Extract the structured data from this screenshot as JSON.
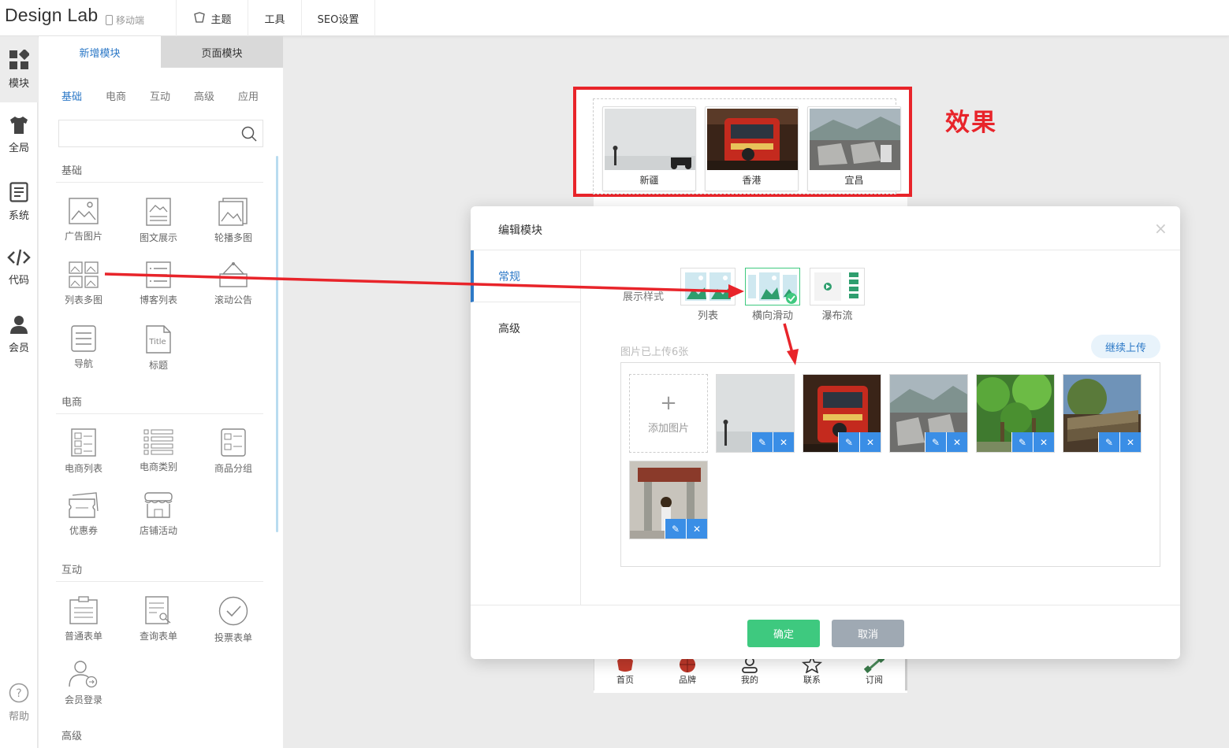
{
  "app": {
    "title": "Design Lab",
    "mobile_label": "移动端"
  },
  "topnav": [
    {
      "label": "主题",
      "icon": "theme-icon"
    },
    {
      "label": "工具"
    },
    {
      "label": "SEO设置"
    }
  ],
  "rail": [
    {
      "label": "模块",
      "icon": "modules-icon",
      "active": true
    },
    {
      "label": "全局",
      "icon": "shirt-icon"
    },
    {
      "label": "系统",
      "icon": "document-icon"
    },
    {
      "label": "代码",
      "icon": "code-icon"
    },
    {
      "label": "会员",
      "icon": "user-icon"
    },
    {
      "label": "帮助",
      "icon": "help-icon"
    }
  ],
  "panel": {
    "tabs": [
      {
        "label": "新增模块",
        "active": true
      },
      {
        "label": "页面模块"
      }
    ],
    "categories": [
      "基础",
      "电商",
      "互动",
      "高级",
      "应用"
    ],
    "search_placeholder": "",
    "sections": [
      {
        "title": "基础",
        "items": [
          "广告图片",
          "图文展示",
          "轮播多图",
          "列表多图",
          "博客列表",
          "滚动公告",
          "导航",
          "标题"
        ]
      },
      {
        "title": "电商",
        "items": [
          "电商列表",
          "电商类别",
          "商品分组",
          "优惠券",
          "店铺活动"
        ]
      },
      {
        "title": "互动",
        "items": [
          "普通表单",
          "查询表单",
          "投票表单",
          "会员登录"
        ]
      },
      {
        "title": "高级",
        "items": []
      }
    ]
  },
  "preview": {
    "cards": [
      {
        "label": "新疆"
      },
      {
        "label": "香港"
      },
      {
        "label": "宜昌"
      }
    ],
    "annotation": "效果"
  },
  "phone_nav": [
    "首页",
    "品牌",
    "我的",
    "联系",
    "订阅"
  ],
  "modal": {
    "title": "编辑模块",
    "close": "×",
    "tabs": [
      {
        "label": "常规",
        "active": true
      },
      {
        "label": "高级"
      }
    ],
    "style_label": "展示样式",
    "styles": [
      {
        "label": "列表"
      },
      {
        "label": "横向滑动",
        "selected": true
      },
      {
        "label": "瀑布流"
      }
    ],
    "uploaded_text": "图片已上传6张",
    "continue_upload": "继续上传",
    "add_image": "添加图片",
    "add_plus": "+",
    "edit_icon": "✎",
    "delete_icon": "✕",
    "confirm": "确定",
    "cancel": "取消"
  },
  "colors": {
    "accent": "#2d79c7",
    "annotation_red": "#e8242a",
    "confirm_green": "#3ec97f",
    "cancel_gray": "#9fa9b3"
  }
}
